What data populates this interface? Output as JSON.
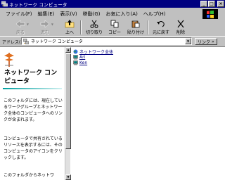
{
  "window": {
    "title": "ネットワーク コンピュータ"
  },
  "menu": {
    "items": [
      "ファイル(F)",
      "編集(E)",
      "表示(V)",
      "移動(G)",
      "お気に入り(A)",
      "ヘルプ(H)"
    ]
  },
  "toolbar": {
    "buttons": [
      "戻る",
      "進む",
      "上へ",
      "切り取り",
      "コピー",
      "貼り付け",
      "元に戻す",
      "削除"
    ]
  },
  "address": {
    "label": "アドレス(D)",
    "value": "ネットワーク コンピュータ",
    "links_label": "リンク"
  },
  "left_pane": {
    "title": "ネットワーク コンピュータ",
    "paragraphs": [
      "このフォルダには、現在しているワークグループとネットワーク全体のコンピュータへのリンクが含まれます。",
      "コンピュータで共有されているリソースを表示するには、そのコンピュータのアイコンをクリックします。",
      "このフォルダからネットワ"
    ]
  },
  "files": [
    {
      "name": "ネットワーク全体",
      "icon": "globe-icon"
    },
    {
      "name": "Ari",
      "icon": "computer-icon"
    },
    {
      "name": "Ken",
      "icon": "computer-icon"
    }
  ],
  "colors": {
    "titlebar": "#000080",
    "face": "#c0c0c0",
    "accent": "#00a0a0"
  }
}
